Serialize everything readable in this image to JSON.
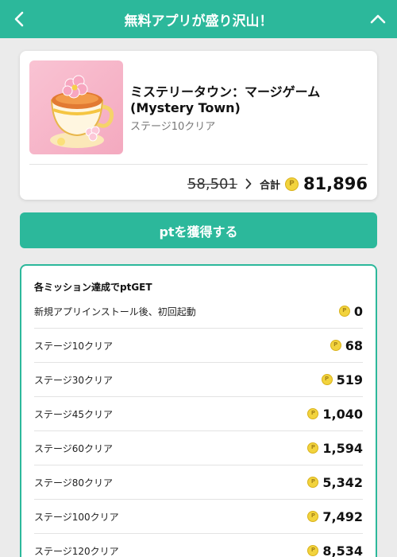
{
  "header": {
    "title": "無料アプリが盛り沢山！",
    "back_icon": "chevron-left-icon",
    "collapse_icon": "chevron-up-icon"
  },
  "app": {
    "name": "ミステリータウン：マージゲーム (Mystery Town)",
    "subtitle": "ステージ10クリア",
    "old_points": "58,501",
    "total_label": "合計",
    "total_points": "81,896",
    "icon": "teacup-app-icon"
  },
  "cta": {
    "label": "ptを獲得する"
  },
  "missions": {
    "title": "各ミッション達成でptGET",
    "coin_glyph": "P",
    "items": [
      {
        "label": "新規アプリインストール後、初回起動",
        "points": "0"
      },
      {
        "label": "ステージ10クリア",
        "points": "68"
      },
      {
        "label": "ステージ30クリア",
        "points": "519"
      },
      {
        "label": "ステージ45クリア",
        "points": "1,040"
      },
      {
        "label": "ステージ60クリア",
        "points": "1,594"
      },
      {
        "label": "ステージ80クリア",
        "points": "5,342"
      },
      {
        "label": "ステージ100クリア",
        "points": "7,492"
      },
      {
        "label": "ステージ120クリア",
        "points": "8,534"
      }
    ]
  },
  "colors": {
    "accent": "#2cb89b",
    "coin": "#f2d33d",
    "background": "#ebebeb"
  }
}
